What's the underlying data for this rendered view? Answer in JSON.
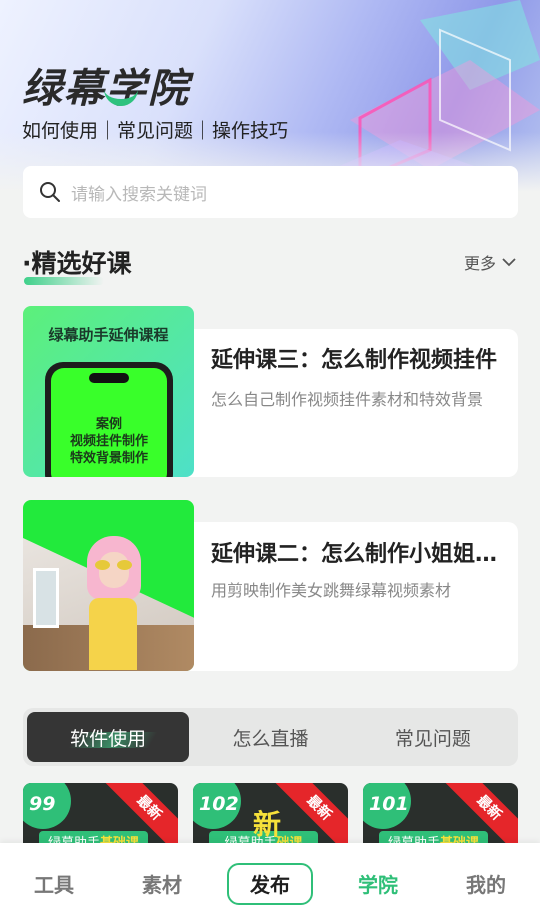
{
  "header": {
    "brand": "绿幕学院",
    "subtitle": "如何使用｜常见问题｜操作技巧"
  },
  "search": {
    "placeholder": "请输入搜索关键词"
  },
  "featured": {
    "title": "·精选好课",
    "more_label": "更多",
    "courses": [
      {
        "thumb_title": "绿幕助手延伸课程",
        "thumb_lines": [
          "案例",
          "视频挂件制作",
          "特效背景制作"
        ],
        "title": "延伸课三：怎么制作视频挂件",
        "desc": "怎么自己制作视频挂件素材和特效背景"
      },
      {
        "title": "延伸课二：怎么制作小姐姐跳舞",
        "desc": "用剪映制作美女跳舞绿幕视频素材"
      }
    ]
  },
  "tabs": [
    "软件使用",
    "怎么直播",
    "常见问题"
  ],
  "mini_cards": [
    {
      "num": "99",
      "ribbon": "最新",
      "strip_a": "绿幕助手",
      "strip_b": "基础课"
    },
    {
      "num": "102",
      "ribbon": "最新",
      "big": "新",
      "strip_a": "绿幕助手",
      "strip_b": "础课"
    },
    {
      "num": "101",
      "ribbon": "最新",
      "strip_a": "绿幕助手",
      "strip_b": "基础课"
    }
  ],
  "nav": {
    "tools": "工具",
    "assets": "素材",
    "publish": "发布",
    "academy": "学院",
    "mine": "我的"
  },
  "colors": {
    "accent": "#2fbf78",
    "dark_tab": "#353535",
    "ribbon": "#e5262a"
  }
}
